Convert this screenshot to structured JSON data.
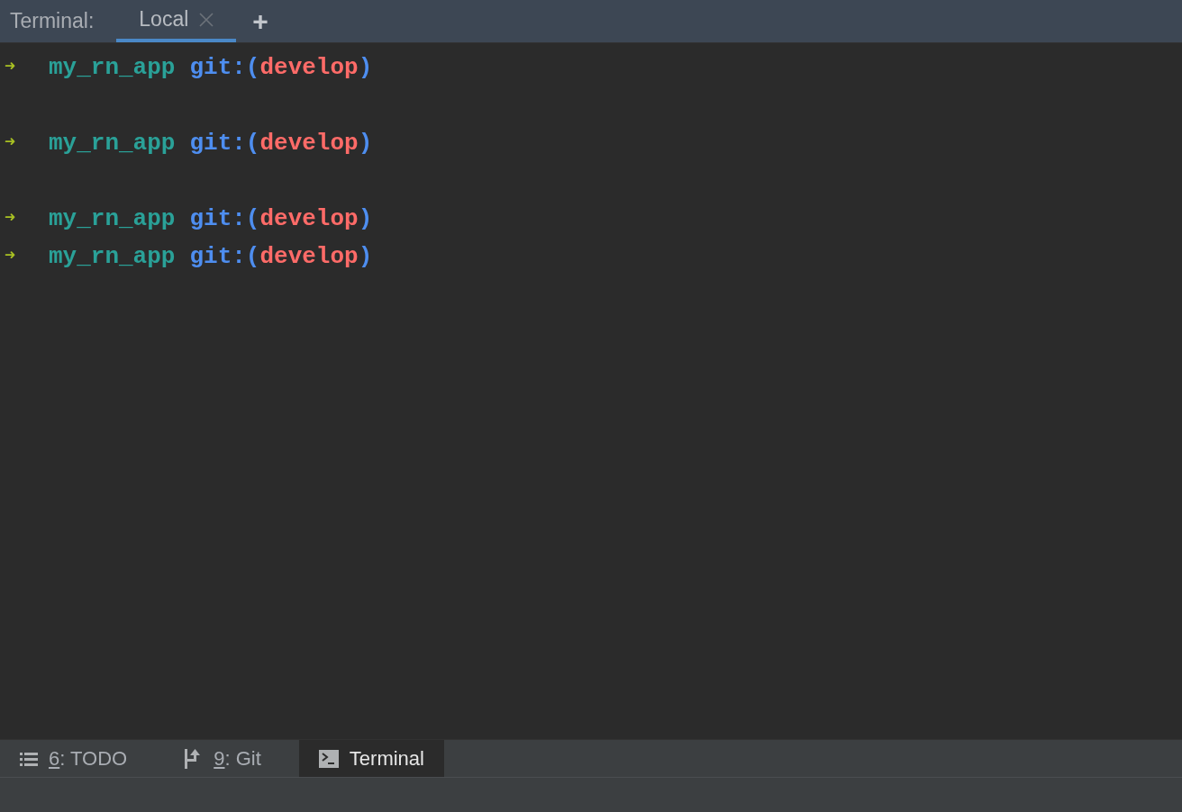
{
  "header": {
    "title": "Terminal:",
    "tabs": [
      {
        "label": "Local",
        "selected": true
      }
    ],
    "add": "+"
  },
  "lines": [
    {
      "kind": "prompt",
      "arrow": "➜",
      "dir": "my_rn_app",
      "git": "git:(",
      "branch": "develop",
      "close": ")"
    },
    {
      "kind": "blank"
    },
    {
      "kind": "prompt",
      "arrow": "➜",
      "dir": "my_rn_app",
      "git": "git:(",
      "branch": "develop",
      "close": ")"
    },
    {
      "kind": "blank"
    },
    {
      "kind": "prompt",
      "arrow": "➜",
      "dir": "my_rn_app",
      "git": "git:(",
      "branch": "develop",
      "close": ")"
    },
    {
      "kind": "prompt",
      "arrow": "➜",
      "dir": "my_rn_app",
      "git": "git:(",
      "branch": "develop",
      "close": ")"
    }
  ],
  "tool_tabs": [
    {
      "kind": "todo",
      "mnemonic": "6",
      "label": ": TODO",
      "selected": false
    },
    {
      "kind": "git",
      "mnemonic": "9",
      "label": ": Git",
      "selected": false
    },
    {
      "kind": "terminal",
      "label": "Terminal",
      "selected": true
    }
  ]
}
